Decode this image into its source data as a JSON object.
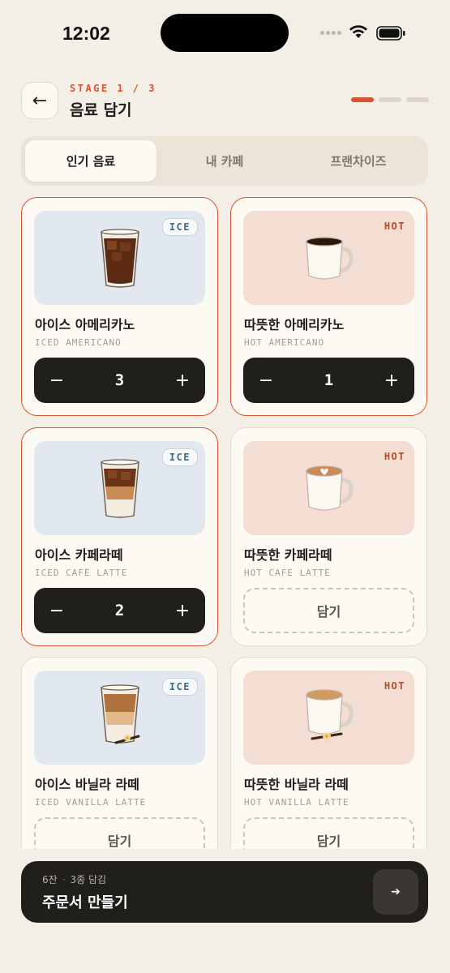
{
  "status": {
    "time": "12:02"
  },
  "header": {
    "back_icon": "←",
    "stage": "STAGE 1 / 3",
    "title": "음료 담기",
    "progress": {
      "current": 1,
      "total": 3
    }
  },
  "tabs": [
    {
      "label": "인기 음료",
      "active": true
    },
    {
      "label": "내 카페",
      "active": false
    },
    {
      "label": "프랜차이즈",
      "active": false
    }
  ],
  "drinks": [
    {
      "name": "아이스 아메리카노",
      "eng": "ICED AMERICANO",
      "temp": "ICE",
      "qty": "3",
      "selected": true,
      "icon": "iced-americano-icon"
    },
    {
      "name": "따뜻한 아메리카노",
      "eng": "HOT AMERICANO",
      "temp": "HOT",
      "qty": "1",
      "selected": true,
      "icon": "hot-americano-icon"
    },
    {
      "name": "아이스 카페라떼",
      "eng": "ICED CAFE LATTE",
      "temp": "ICE",
      "qty": "2",
      "selected": true,
      "icon": "iced-latte-icon"
    },
    {
      "name": "따뜻한 카페라떼",
      "eng": "HOT CAFE LATTE",
      "temp": "HOT",
      "add_label": "담기",
      "selected": false,
      "icon": "hot-latte-icon"
    },
    {
      "name": "아이스 바닐라 라떼",
      "eng": "ICED VANILLA LATTE",
      "temp": "ICE",
      "add_label": "담기",
      "selected": false,
      "icon": "iced-vanilla-latte-icon"
    },
    {
      "name": "따뜻한 바닐라 라떼",
      "eng": "HOT VANILLA LATTE",
      "temp": "HOT",
      "add_label": "담기",
      "selected": false,
      "icon": "hot-vanilla-latte-icon"
    }
  ],
  "stepper": {
    "minus": "−",
    "plus": "+"
  },
  "order": {
    "cups": "6잔",
    "separator": "·",
    "kinds": "3종 담김",
    "label": "주문서 만들기",
    "go_icon": "➔"
  },
  "colors": {
    "accent": "#d9532f",
    "dark": "#211f1c",
    "ice_bg": "#e1e8ef",
    "hot_bg": "#f4ddd2"
  }
}
